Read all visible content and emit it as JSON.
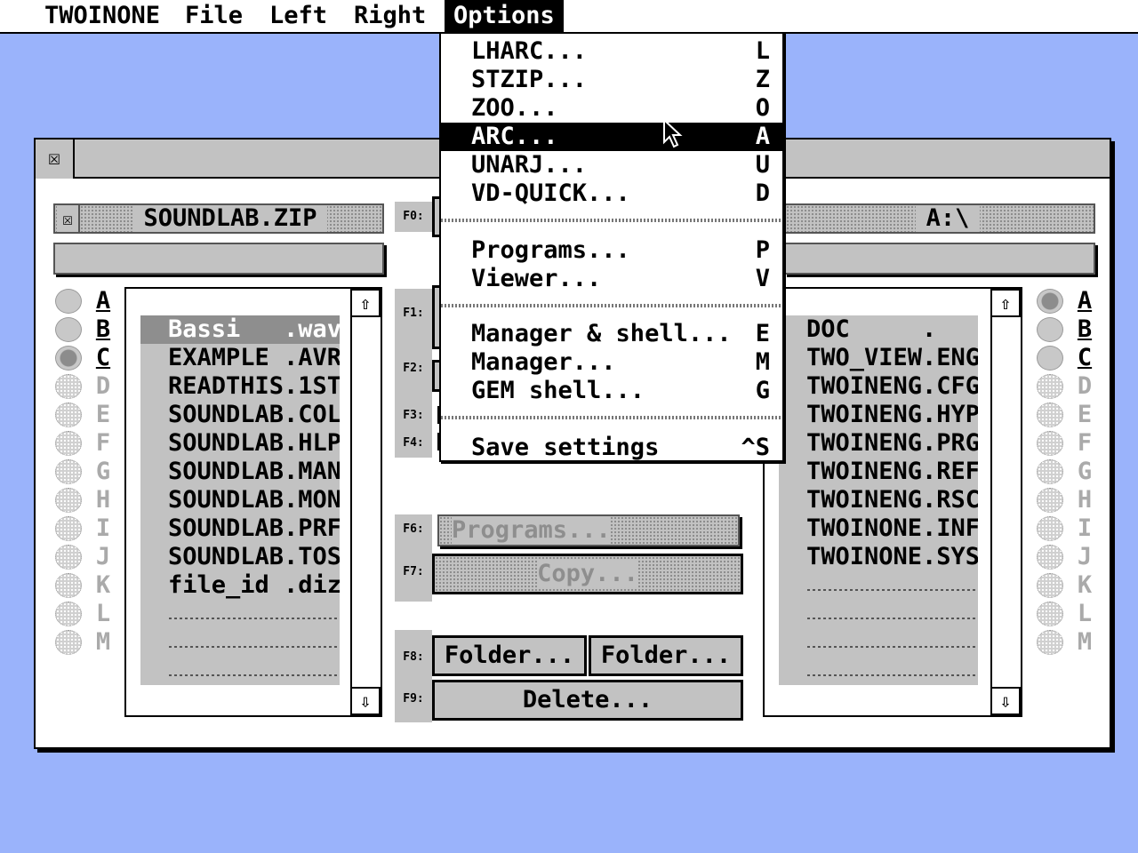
{
  "menubar": {
    "items": [
      "TWOINONE",
      "File",
      "Left",
      "Right",
      "Options"
    ]
  },
  "window": {
    "left_path": "SOUNDLAB.ZIP",
    "right_path": "A:\\",
    "left_files": [
      "Bassi   .wav",
      "EXAMPLE .AVR",
      "READTHIS.1ST",
      "SOUNDLAB.COL",
      "SOUNDLAB.HLP",
      "SOUNDLAB.MAN",
      "SOUNDLAB.MON",
      "SOUNDLAB.PRF",
      "SOUNDLAB.TOS",
      "file_id .diz"
    ],
    "right_files": [
      "DOC     .",
      "TWO_VIEW.ENG",
      "TWOINENG.CFG",
      "TWOINENG.HYP",
      "TWOINENG.PRG",
      "TWOINENG.REF",
      "TWOINENG.RSC",
      "TWOINONE.INF",
      "TWOINONE.SYS"
    ],
    "drives": [
      "A",
      "B",
      "C",
      "D",
      "E",
      "F",
      "G",
      "H",
      "I",
      "J",
      "K",
      "L",
      "M"
    ],
    "fkeys": {
      "f0": "F0:",
      "f1": "F1:",
      "f2": "F2:",
      "f3": "F3:",
      "f4": "F4:",
      "f6": "F6:",
      "f7": "F7:",
      "f8": "F8:",
      "f9": "F9:"
    },
    "buttons": {
      "programs": "Programs...",
      "copy": "Copy...",
      "folder_left": "Folder...",
      "folder_right": "Folder...",
      "delete": "Delete..."
    }
  },
  "options_menu": [
    {
      "label": "LHARC...",
      "key": "L"
    },
    {
      "label": "STZIP...",
      "key": "Z"
    },
    {
      "label": "ZOO...",
      "key": "O"
    },
    {
      "label": "ARC...",
      "key": "A"
    },
    {
      "label": "UNARJ...",
      "key": "U"
    },
    {
      "label": "VD-QUICK...",
      "key": "D"
    },
    {
      "label": "Programs...",
      "key": "P"
    },
    {
      "label": "Viewer...",
      "key": "V"
    },
    {
      "label": "Manager & shell...",
      "key": "E"
    },
    {
      "label": "Manager...",
      "key": "M"
    },
    {
      "label": "GEM shell...",
      "key": "G"
    },
    {
      "label": "Save settings",
      "key": "^S"
    }
  ],
  "icons": {
    "close": "close-icon",
    "up": "⇧",
    "down": "⇩"
  },
  "colors": {
    "desktop": "#9ab3fb",
    "highlight": "#000000"
  }
}
